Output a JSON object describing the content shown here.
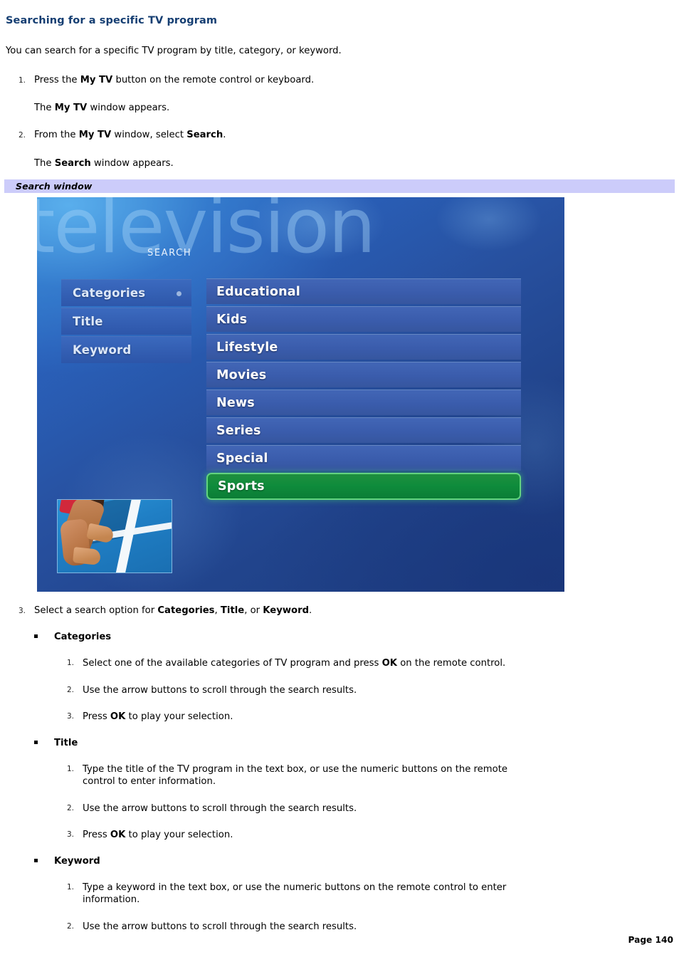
{
  "document": {
    "title": "Searching for a specific TV program",
    "intro": "You can search for a specific TV program by title, category, or keyword.",
    "footer": "Page 140",
    "heading_color": "#153e72",
    "caption_bar_color": "#ccccfa"
  },
  "steps": [
    {
      "num": "1.",
      "text_html": "Press the <b>My TV</b> button on the remote control or keyboard."
    },
    {
      "num": "",
      "text_html": "The <b>My TV</b> window appears."
    },
    {
      "num": "2.",
      "text_html": "From the <b>My TV</b> window, select <b>Search</b>."
    },
    {
      "num": "",
      "text_html": "The <b>Search</b> window appears."
    }
  ],
  "figure": {
    "caption": "Search window",
    "screen": {
      "watermark": "television",
      "header": "SEARCH",
      "nav_items": [
        {
          "label": "Categories",
          "selected": true
        },
        {
          "label": "Title",
          "selected": false
        },
        {
          "label": "Keyword",
          "selected": false
        }
      ],
      "categories": [
        {
          "label": "Educational",
          "selected": false
        },
        {
          "label": "Kids",
          "selected": false
        },
        {
          "label": "Lifestyle",
          "selected": false
        },
        {
          "label": "Movies",
          "selected": false
        },
        {
          "label": "News",
          "selected": false
        },
        {
          "label": "Series",
          "selected": false
        },
        {
          "label": "Special",
          "selected": false
        },
        {
          "label": "Sports",
          "selected": true
        }
      ],
      "selected_category": "Sports",
      "highlight_color": "#0f8c3c",
      "thumbnail_alt": "sprinter hands at starting line on blue track"
    }
  },
  "step3": {
    "num": "3.",
    "text_html": "Select a search option for <b>Categories</b>, <b>Title</b>, or <b>Keyword</b>."
  },
  "options": [
    {
      "label": "Categories",
      "substeps": [
        {
          "num": "1.",
          "text_html": "Select one of the available categories of TV program and press <b>OK</b> on the remote control."
        },
        {
          "num": "2.",
          "text_html": "Use the arrow buttons to scroll through the search results."
        },
        {
          "num": "3.",
          "text_html": "Press <b>OK</b> to play your selection."
        }
      ]
    },
    {
      "label": "Title",
      "substeps": [
        {
          "num": "1.",
          "text_html": "Type the title of the TV program in the text box, or use the numeric buttons on the remote<br>control to enter information."
        },
        {
          "num": "2.",
          "text_html": "Use the arrow buttons to scroll through the search results."
        },
        {
          "num": "3.",
          "text_html": "Press <b>OK</b> to play your selection."
        }
      ]
    },
    {
      "label": "Keyword",
      "substeps": [
        {
          "num": "1.",
          "text_html": "Type a keyword in the text box, or use the numeric buttons on the remote control to enter<br>information."
        },
        {
          "num": "2.",
          "text_html": "Use the arrow buttons to scroll through the search results."
        }
      ]
    }
  ]
}
